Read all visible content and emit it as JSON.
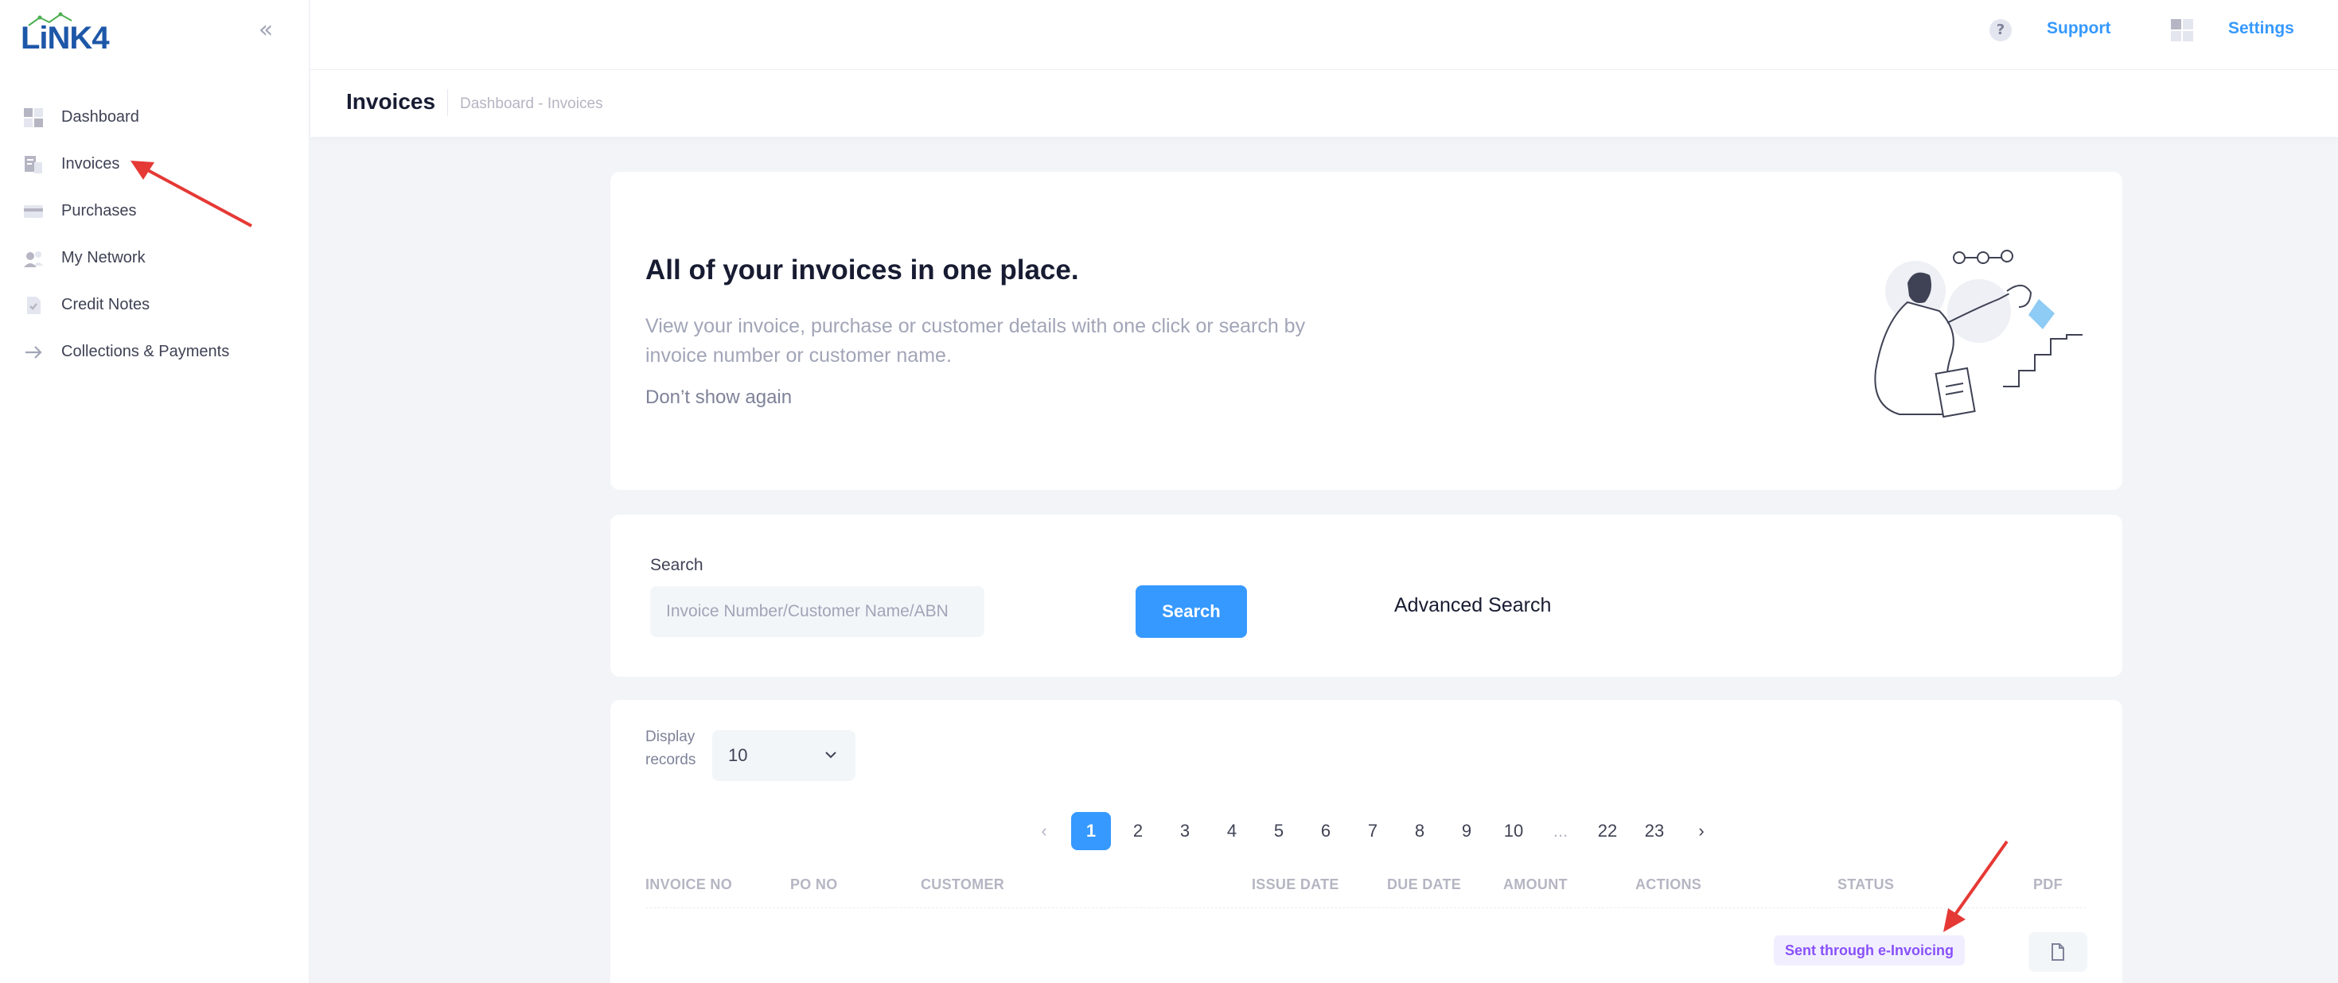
{
  "brand": {
    "logo_text": "LiNK4",
    "accent": "#3699ff",
    "logo_color": "#1d57a8"
  },
  "sidebar": {
    "collapse_icon": "double-chevron-left-icon",
    "items": [
      {
        "label": "Dashboard",
        "icon": "dashboard-icon"
      },
      {
        "label": "Invoices",
        "icon": "invoice-icon"
      },
      {
        "label": "Purchases",
        "icon": "card-icon"
      },
      {
        "label": "My Network",
        "icon": "network-icon"
      },
      {
        "label": "Credit Notes",
        "icon": "document-icon"
      },
      {
        "label": "Collections & Payments",
        "icon": "arrow-right-icon"
      }
    ]
  },
  "topbar": {
    "support_label": "Support",
    "settings_label": "Settings",
    "help_glyph": "?"
  },
  "subheader": {
    "title": "Invoices",
    "breadcrumb": "Dashboard - Invoices"
  },
  "hero": {
    "title": "All of your invoices in one place.",
    "description": "View your invoice, purchase or customer details with one click or search by invoice number or customer name.",
    "dismiss_label": "Don’t show again"
  },
  "search": {
    "label": "Search",
    "placeholder": "Invoice Number/Customer Name/ABN",
    "button_label": "Search",
    "advanced_label": "Advanced Search"
  },
  "table": {
    "display_label": "Display records",
    "display_value": "10",
    "pagination": {
      "prev": "‹",
      "pages": [
        "1",
        "2",
        "3",
        "4",
        "5",
        "6",
        "7",
        "8",
        "9",
        "10",
        "...",
        "22",
        "23"
      ],
      "active": "1",
      "next": "›"
    },
    "columns": [
      "INVOICE NO",
      "PO NO",
      "CUSTOMER",
      "ISSUE DATE",
      "DUE DATE",
      "AMOUNT",
      "ACTIONS",
      "STATUS",
      "PDF"
    ],
    "rows": [
      {
        "status": "Sent through e-Invoicing"
      }
    ]
  }
}
